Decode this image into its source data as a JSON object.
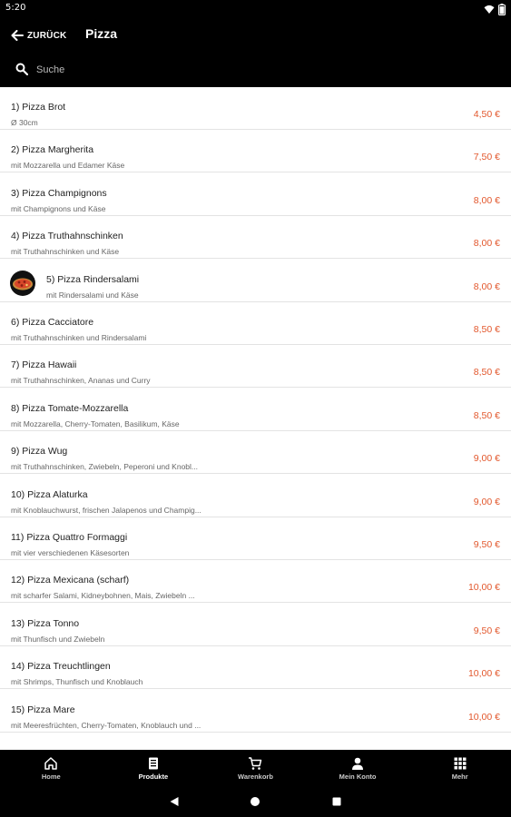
{
  "status_bar": {
    "time": "5:20"
  },
  "app_bar": {
    "back_label": "ZURÜCK",
    "title": "Pizza"
  },
  "search": {
    "placeholder": "Suche"
  },
  "colors": {
    "accent": "#e2572c",
    "bar_bg": "#000000"
  },
  "items": [
    {
      "name": "1) Pizza Brot",
      "desc": "Ø 30cm",
      "price": "4,50 €"
    },
    {
      "name": "2) Pizza Margherita",
      "desc": "mit Mozzarella und Edamer Käse",
      "price": "7,50 €"
    },
    {
      "name": "3) Pizza Champignons",
      "desc": "mit Champignons und Käse",
      "price": "8,00 €"
    },
    {
      "name": "4) Pizza Truthahnschinken",
      "desc": "mit Truthahnschinken und Käse",
      "price": "8,00 €"
    },
    {
      "name": "5) Pizza Rindersalami",
      "desc": "mit Rindersalami und Käse",
      "price": "8,00 €",
      "image": "pizza-thumbnail"
    },
    {
      "name": "6) Pizza Cacciatore",
      "desc": "mit Truthahnschinken und Rindersalami",
      "price": "8,50 €"
    },
    {
      "name": "7) Pizza Hawaii",
      "desc": "mit Truthahnschinken, Ananas und Curry",
      "price": "8,50 €"
    },
    {
      "name": "8) Pizza Tomate-Mozzarella",
      "desc": "mit Mozzarella, Cherry-Tomaten, Basilikum, Käse",
      "price": "8,50 €"
    },
    {
      "name": "9) Pizza Wug",
      "desc": "mit Truthahnschinken, Zwiebeln, Peperoni und Knobl...",
      "price": "9,00 €"
    },
    {
      "name": "10) Pizza Alaturka",
      "desc": "mit Knoblauchwurst, frischen Jalapenos und Champig...",
      "price": "9,00 €"
    },
    {
      "name": "11) Pizza Quattro Formaggi",
      "desc": "mit vier verschiedenen Käsesorten",
      "price": "9,50 €"
    },
    {
      "name": "12) Pizza Mexicana (scharf)",
      "desc": "mit scharfer Salami, Kidneybohnen, Mais, Zwiebeln ...",
      "price": "10,00 €"
    },
    {
      "name": "13) Pizza Tonno",
      "desc": "mit Thunfisch und Zwiebeln",
      "price": "9,50 €"
    },
    {
      "name": "14) Pizza Treuchtlingen",
      "desc": "mit Shrimps, Thunfisch und Knoblauch",
      "price": "10,00 €"
    },
    {
      "name": "15) Pizza Mare",
      "desc": "mit Meeresfrüchten, Cherry-Tomaten, Knoblauch und ...",
      "price": "10,00 €"
    }
  ],
  "bottom_nav": [
    {
      "label": "Home",
      "icon": "home-icon"
    },
    {
      "label": "Produkte",
      "icon": "menu-card-icon",
      "active": true
    },
    {
      "label": "Warenkorb",
      "icon": "cart-icon"
    },
    {
      "label": "Mein Konto",
      "icon": "person-icon"
    },
    {
      "label": "Mehr",
      "icon": "grid-icon"
    }
  ]
}
